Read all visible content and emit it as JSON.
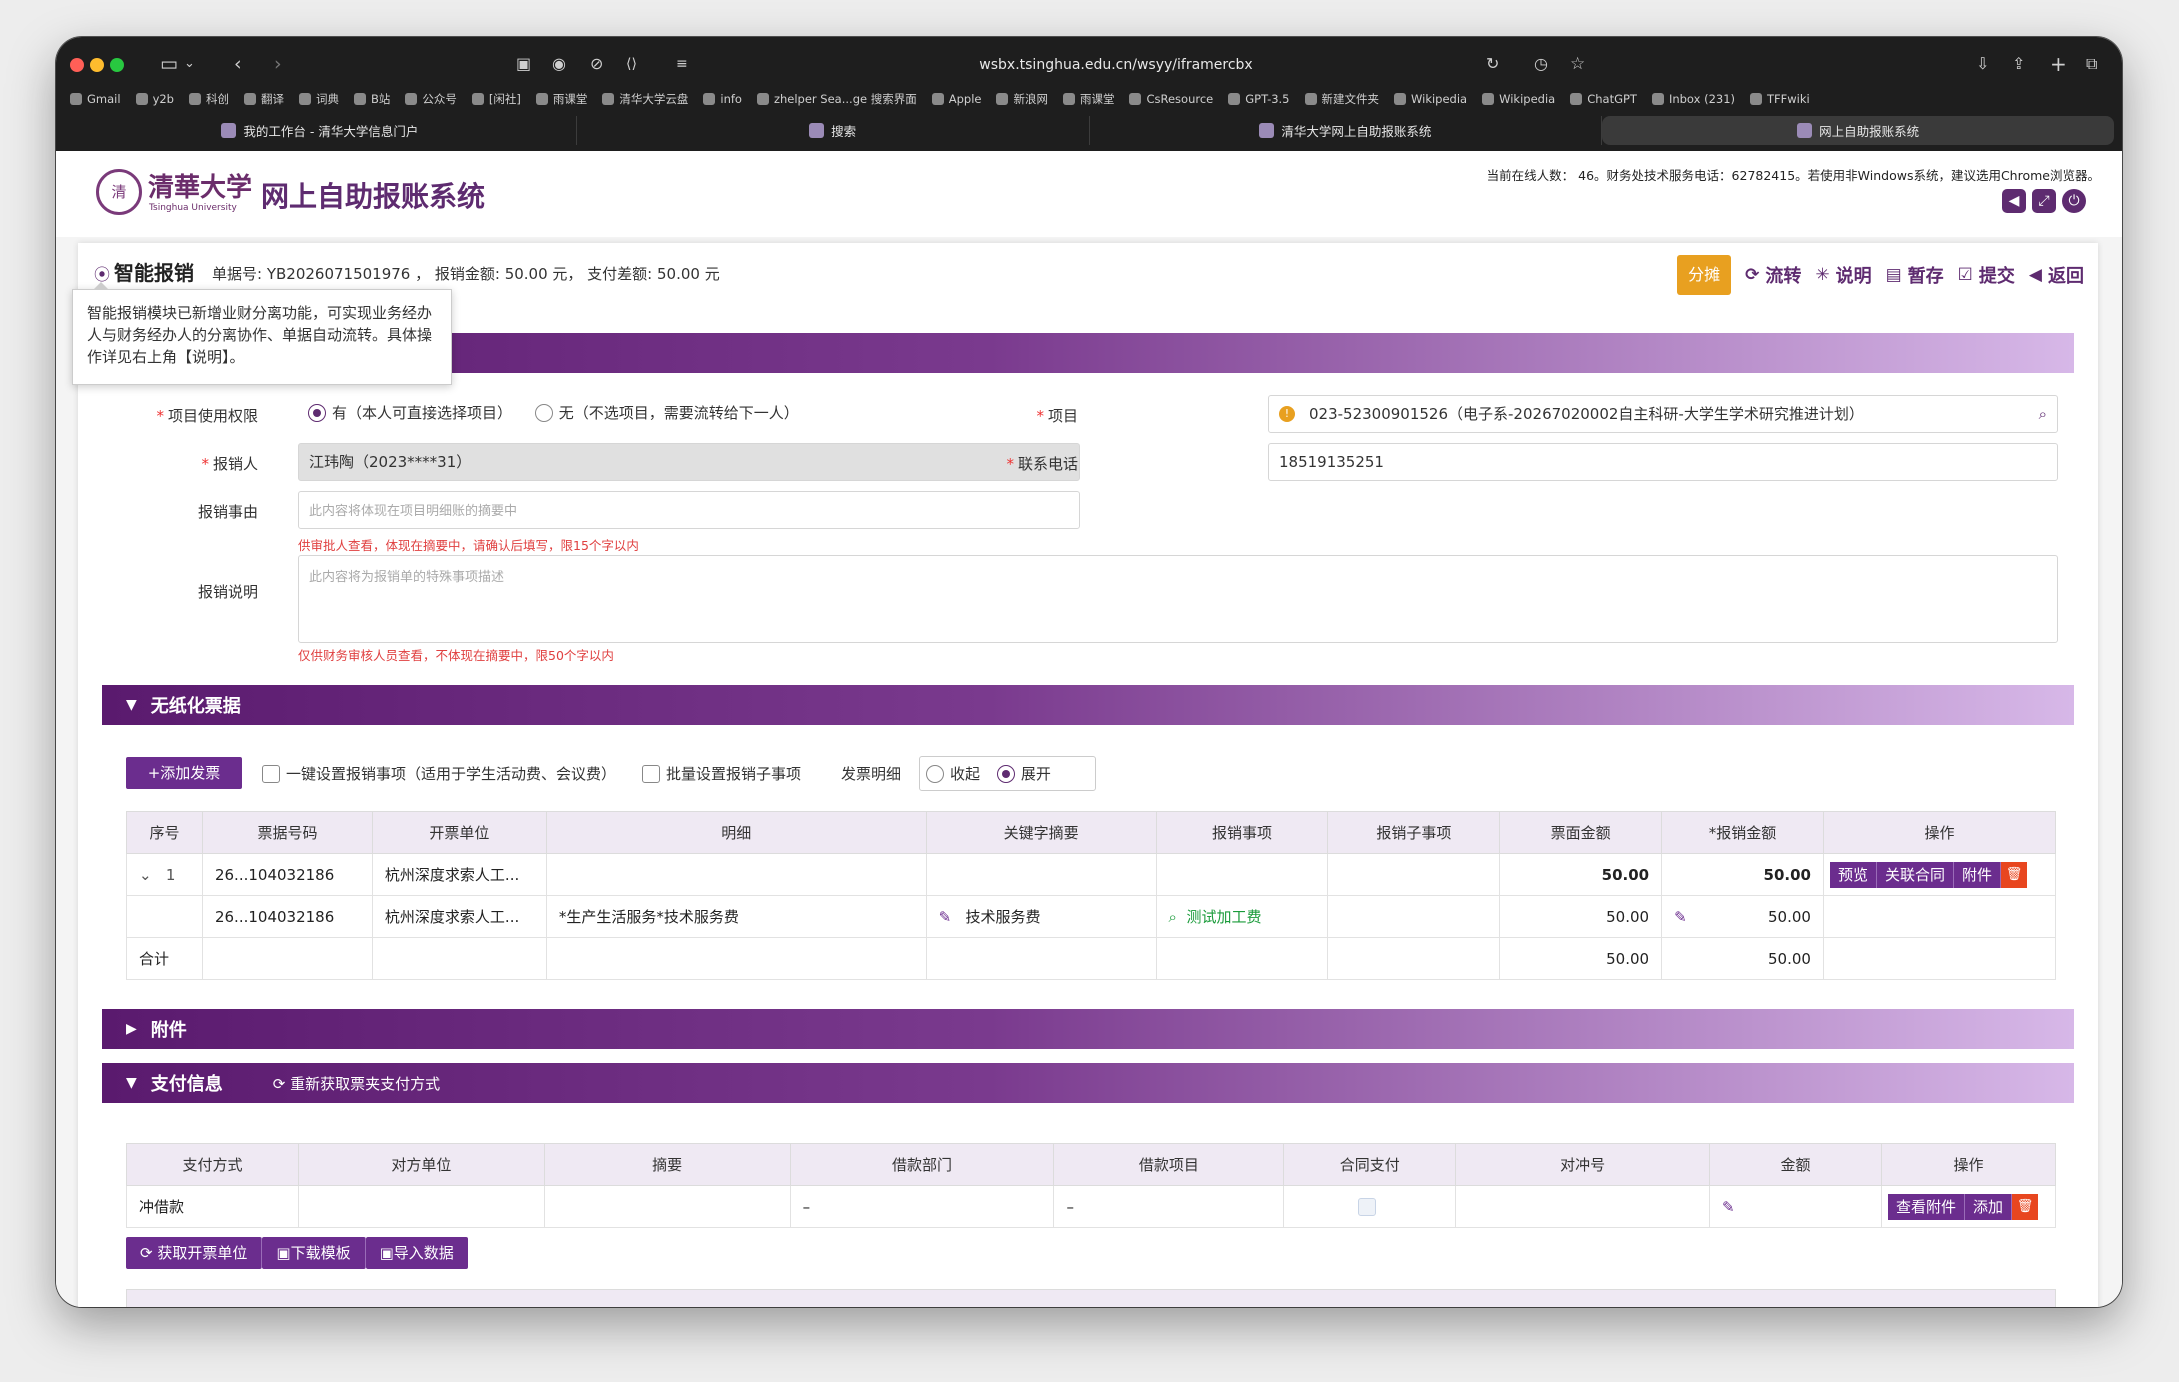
{
  "browser": {
    "url": "wsbx.tsinghua.edu.cn/wsyy/iframercbx",
    "bookmarks": [
      "Gmail",
      "y2b",
      "科创",
      "翻译",
      "词典",
      "B站",
      "公众号",
      "[闲社]",
      "雨课堂",
      "清华大学云盘",
      "info",
      "zhelper Sea...ge 搜索界面",
      "Apple",
      "新浪网",
      "雨课堂",
      "CsResource",
      "GPT-3.5",
      "新建文件夹",
      "Wikipedia",
      "Wikipedia",
      "ChatGPT",
      "Inbox (231)",
      "TFFwiki"
    ],
    "tabs": [
      "我的工作台 - 清华大学信息门户",
      "搜索",
      "清华大学网上自助报账系统",
      "网上自助报账系统"
    ]
  },
  "header": {
    "logo_cn": "清華大学",
    "logo_en": "Tsinghua University",
    "system_title": "网上自助报账系统",
    "online_info": "当前在线人数： 46。财务处技术服务电话：62782415。若使用非Windows系统，建议选用Chrome浏览器。"
  },
  "titlebar": {
    "title": "智能报销",
    "meta": "单据号:  YB2026071501976 ，  报销金额: 50.00 元，  支付差额: 50.00 元",
    "split": "分摊",
    "actions": [
      "流转",
      "说明",
      "暂存",
      "提交",
      "返回"
    ]
  },
  "tooltip": "智能报销模块已新增业财分离功能，可实现业务经办人与财务经办人的分离协作、单据自动流转。具体操作详见右上角【说明】。",
  "form": {
    "perm_label": "项目使用权限",
    "perm_opt1": "有（本人可直接选择项目）",
    "perm_opt2": "无（不选项目，需要流转给下一人）",
    "project_label": "项目",
    "project_value": "023-52300901526（电子系-20267020002自主科研-大学生学术研究推进计划）",
    "reimburser_label": "报销人",
    "reimburser_value": "江玮陶（2023****31）",
    "phone_label": "联系电话",
    "phone_value": "18519135251",
    "reason_label": "报销事由",
    "reason_placeholder": "此内容将体现在项目明细账的摘要中",
    "reason_hint": "供审批人查看，体现在摘要中，请确认后填写，限15个字以内",
    "desc_label": "报销说明",
    "desc_placeholder": "此内容将为报销单的特殊事项描述",
    "desc_hint": "仅供财务审核人员查看，不体现在摘要中，限50个字以内"
  },
  "invoice": {
    "section_title": "无纸化票据",
    "add_btn": "+添加发票",
    "check1": "一键设置报销事项（适用于学生活动费、会议费）",
    "check2": "批量设置报销子事项",
    "detail_label": "发票明细",
    "collapse": "收起",
    "expand": "展开",
    "columns": [
      "序号",
      "票据号码",
      "开票单位",
      "明细",
      "关键字摘要",
      "报销事项",
      "报销子事项",
      "票面金额",
      "*报销金额",
      "操作"
    ],
    "row1": {
      "seq": "1",
      "no": "26...104032186",
      "issuer": "杭州深度求索人工...",
      "amount": "50.00",
      "reimb": "50.00",
      "ops": [
        "预览",
        "关联合同",
        "附件"
      ]
    },
    "row2": {
      "no": "26...104032186",
      "issuer": "杭州深度求索人工...",
      "detail": "*生产生活服务*技术服务费",
      "keyword": "技术服务费",
      "item": "测试加工费",
      "amount": "50.00",
      "reimb": "50.00"
    },
    "total": {
      "label": "合计",
      "amount": "50.00",
      "reimb": "50.00"
    }
  },
  "attachment": {
    "section_title": "附件"
  },
  "payment": {
    "section_title": "支付信息",
    "refetch": "重新获取票夹支付方式",
    "columns": [
      "支付方式",
      "对方单位",
      "摘要",
      "借款部门",
      "借款项目",
      "合同支付",
      "对冲号",
      "金额",
      "操作"
    ],
    "row": {
      "method": "冲借款",
      "dept": "–",
      "proj": "–",
      "ops": [
        "查看附件",
        "添加"
      ]
    },
    "buttons": [
      "获取开票单位",
      "下载模板",
      "导入数据"
    ]
  },
  "colors": {
    "primary": "#5e2b70",
    "accent": "#e8a020",
    "danger": "#e8461f"
  }
}
